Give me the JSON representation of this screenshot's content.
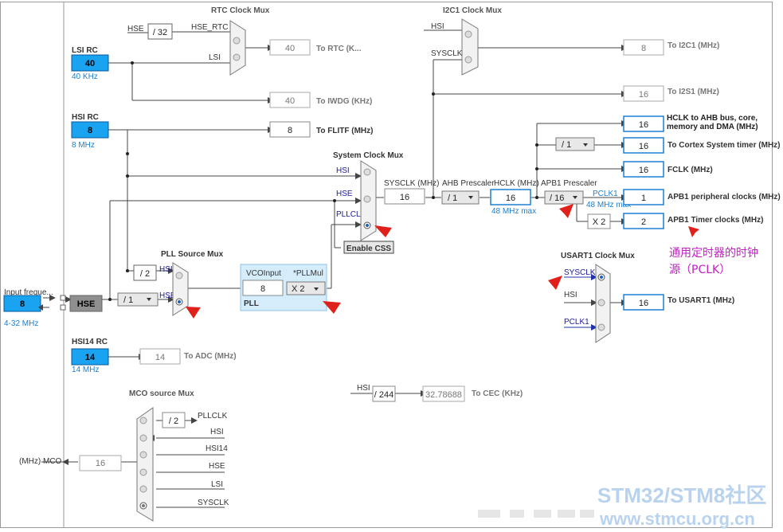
{
  "sources": {
    "lsi": {
      "title": "LSI RC",
      "value": "40",
      "freq": "40 KHz"
    },
    "hsi": {
      "title": "HSI RC",
      "value": "8",
      "freq": "8 MHz"
    },
    "hsi14": {
      "title": "HSI14 RC",
      "value": "14",
      "freq": "14 MHz"
    },
    "input": {
      "title": "Input freque...",
      "value": "8",
      "range": "4-32 MHz"
    },
    "hse_button": "HSE"
  },
  "rtc": {
    "title": "RTC Clock Mux",
    "in_hse": "HSE",
    "div": "/ 32",
    "in_hse_rtc": "HSE_RTC",
    "in_lsi": "LSI",
    "out_value": "40",
    "out_label": "To RTC (K...",
    "iwdg_value": "40",
    "iwdg_label": "To IWDG (KHz)"
  },
  "flitf": {
    "value": "8",
    "label": "To FLITF (MHz)"
  },
  "i2c1": {
    "title": "I2C1 Clock Mux",
    "in_hsi": "HSI",
    "in_sysclk": "SYSCLK",
    "out_value": "8",
    "out_label": "To I2C1 (MHz)",
    "i2s1_value": "16",
    "i2s1_label": "To I2S1 (MHz)"
  },
  "sysmux": {
    "title": "System Clock Mux",
    "in_hsi": "HSI",
    "in_hse": "HSE",
    "in_pllclk": "PLLCLK",
    "css_button": "Enable CSS"
  },
  "sysclk": {
    "label": "SYSCLK (MHz)",
    "value": "16"
  },
  "ahb": {
    "label": "AHB Prescaler",
    "value": "/ 1"
  },
  "hclk": {
    "label": "HCLK (MHz)",
    "value": "16",
    "max": "48 MHz max"
  },
  "apb1": {
    "label": "APB1 Prescaler",
    "value": "/ 16"
  },
  "pclk1": {
    "label": "PCLK1",
    "max": "48 MHz max"
  },
  "outputs": {
    "hclk_bus": {
      "value": "16",
      "label": "HCLK to AHB bus, core, memory and DMA (MHz)"
    },
    "cortex_div": "/ 1",
    "cortex": {
      "value": "16",
      "label": "To Cortex System timer (MHz)"
    },
    "fclk": {
      "value": "16",
      "label": "FCLK (MHz)"
    },
    "apb1_periph": {
      "value": "1",
      "label": "APB1 peripheral clocks (MHz)"
    },
    "timer_mul": "X 2",
    "apb1_timer": {
      "value": "2",
      "label": "APB1 Timer clocks (MHz)"
    }
  },
  "pllsrc": {
    "title": "PLL Source Mux",
    "div": "/ 2",
    "in_hsi": "HSI",
    "in_hse": "HSE",
    "prediv": "/ 1"
  },
  "pll": {
    "vco_label": "VCOInput",
    "mul_label": "*PLLMul",
    "vco_value": "8",
    "mul_value": "X 2",
    "name": "PLL"
  },
  "usart1": {
    "title": "USART1 Clock Mux",
    "in_sysclk": "SYSCLK",
    "in_hsi": "HSI",
    "in_pclk1": "PCLK1",
    "out_value": "16",
    "out_label": "To USART1 (MHz)"
  },
  "adc": {
    "value": "14",
    "label": "To ADC (MHz)"
  },
  "cec": {
    "in_hsi": "HSI",
    "div": "/ 244",
    "value": "32.78688",
    "label": "To CEC (KHz)"
  },
  "mco": {
    "title": "MCO source Mux",
    "div": "/ 2",
    "inputs": [
      "PLLCLK",
      "HSI",
      "HSI14",
      "HSE",
      "LSI",
      "SYSCLK"
    ],
    "value": "16",
    "label": "(MHz) MCO"
  },
  "annotation": {
    "line1": "通用定时器的时钟",
    "line2": "源（PCLK）"
  },
  "watermark": {
    "line1": "STM32/STM8社区",
    "line2": "www.stmcu.org.cn"
  },
  "colors": {
    "source_fill": "#1aa3f0",
    "accent_blue": "#1e7fd0",
    "arrow_red": "#e0201a",
    "annotation": "#c020c0"
  }
}
